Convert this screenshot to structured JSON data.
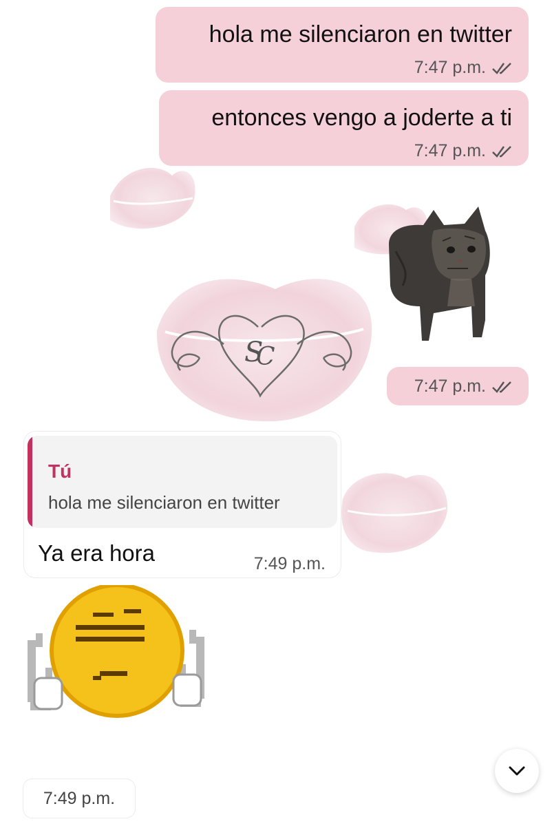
{
  "chat": {
    "messages_out": [
      {
        "text": "hola me silenciaron en twitter",
        "time": "7:47 p.m."
      },
      {
        "text": "entonces vengo a joderte a ti",
        "time": "7:47 p.m."
      },
      {
        "sticker": "cat-sticker",
        "time": "7:47 p.m."
      }
    ],
    "reply": {
      "quote_author": "Tú",
      "quote_text": "hola me silenciaron en twitter",
      "text": "Ya era hora",
      "time": "7:49 p.m."
    },
    "sticker_in": {
      "sticker": "pixel-emoji-sticker",
      "time": "7:49 p.m."
    }
  },
  "wallpaper": {
    "monogram": "SC"
  },
  "icons": {
    "read_receipt": "double-check-icon",
    "scroll_down": "chevron-down-icon"
  },
  "colors": {
    "outgoing_bubble": "#f5d0d9",
    "incoming_bubble": "#ffffff",
    "quote_accent": "#c2315f",
    "read_ticks": "#555555"
  }
}
